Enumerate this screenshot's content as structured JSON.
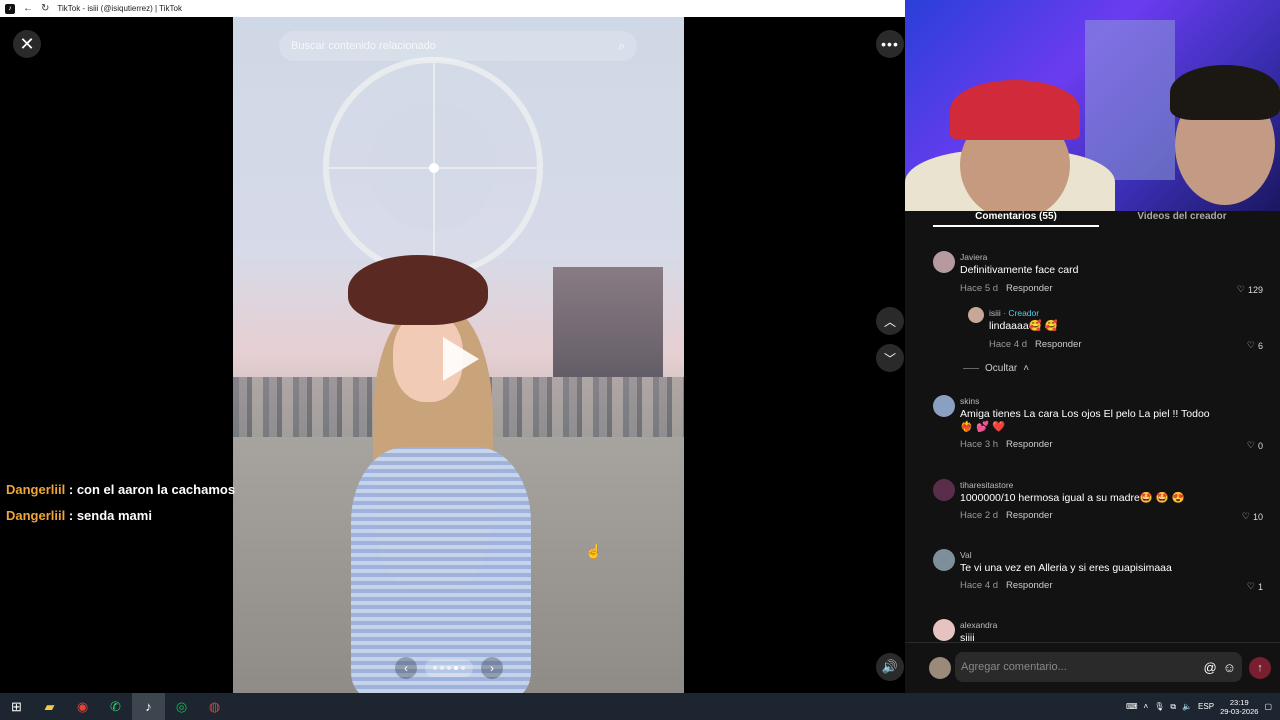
{
  "browser": {
    "title": "TikTok - isiii (@isiqutierrez) | TikTok"
  },
  "viewer": {
    "search_placeholder": "Buscar contenido relacionado",
    "close_glyph": "✕",
    "more_glyph": "•••",
    "up_glyph": "︿",
    "down_glyph": "﹀",
    "volume_glyph": "🔊",
    "prev_glyph": "‹",
    "next_glyph": "›",
    "carousel_dots": 5,
    "carousel_active": 3
  },
  "chat": [
    {
      "user": "Dangerliil",
      "message": ": con el aaron la cachamos"
    },
    {
      "user": "Dangerliil",
      "message": ": senda mami"
    }
  ],
  "panel": {
    "tabs": [
      "Comentarios (55)",
      "Videos del creador"
    ],
    "hide_label": "Ocultar",
    "reply_label": "Responder",
    "comments": [
      {
        "name": "Javiera",
        "text": "Definitivamente face card ",
        "time": "Hace 5 d",
        "likes": "129"
      },
      {
        "name": "isiii",
        "creator": "· Creador",
        "text": "lindaaaa🥰 🥰",
        "time": "Hace 4 d",
        "likes": "6"
      },
      {
        "name": "skins",
        "text": "Amiga tienes La cara Los ojos El pelo La piel !! Todoo ❤️‍🔥 💕 ❤️",
        "time": "Hace 3 h",
        "likes": "0"
      },
      {
        "name": "tiharesitastore",
        "text": "1000000/10 hermosa igual a su madre🤩 🤩 😍",
        "time": "Hace 2 d",
        "likes": "10"
      },
      {
        "name": "Val",
        "text": "Te vi una vez en Alleria y si eres guapisimaaa",
        "time": "Hace 4 d",
        "likes": "1"
      },
      {
        "name": "alexandra",
        "text": "siiii",
        "time": "",
        "likes": ""
      }
    ],
    "comment_placeholder": "Agregar comentario...",
    "at_glyph": "@",
    "emoji_glyph": "☺",
    "send_glyph": "↑",
    "like_glyph": "♡"
  },
  "taskbar": {
    "icons": [
      "windows-icon",
      "explorer-icon",
      "chrome-icon",
      "whatsapp-icon",
      "tiktok-icon",
      "spotify-icon",
      "browser2-icon"
    ],
    "lang": "ESP",
    "time": "23:19",
    "date": "29-03-2026"
  }
}
